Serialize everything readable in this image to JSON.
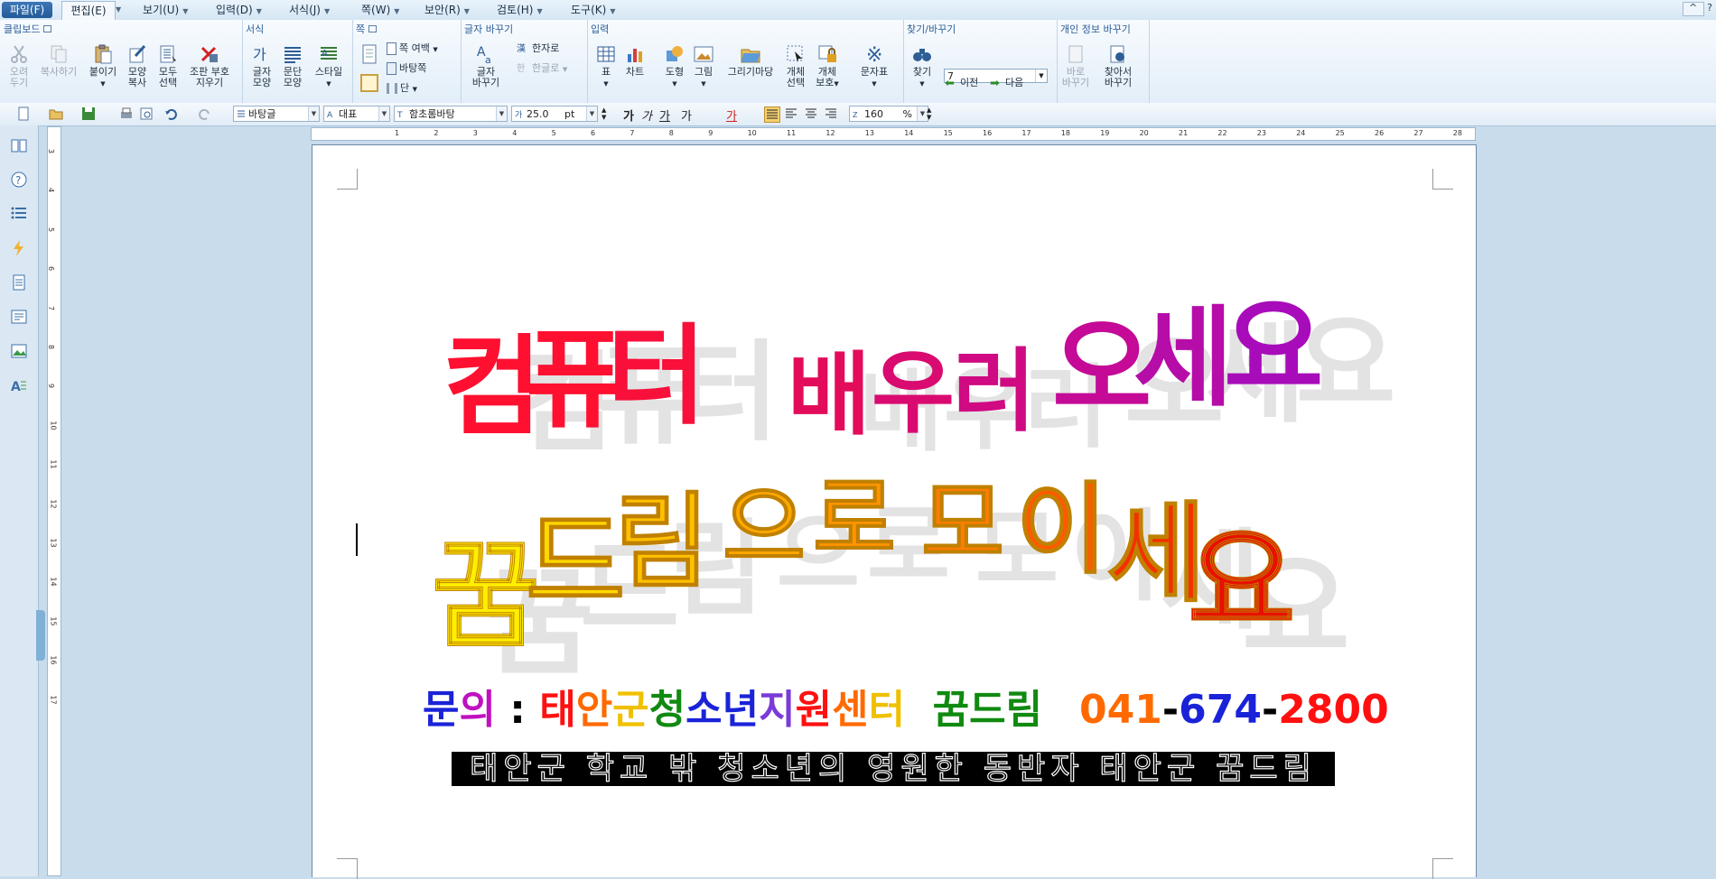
{
  "menu": {
    "items": [
      "파일(F)",
      "편집(E)",
      "보기(U)",
      "입력(D)",
      "서식(J)",
      "쪽(W)",
      "보안(R)",
      "검토(H)",
      "도구(K)"
    ],
    "help": [
      "^",
      "?"
    ]
  },
  "ribbon": {
    "clipboard": {
      "title": "클립보드",
      "cut": "오려\n두기",
      "copy": "복사하기",
      "paste": "붙이기",
      "format_copy": "모양\n복사",
      "select_all": "모두\n선택",
      "remove_marks": "조판 부호\n지우기"
    },
    "format": {
      "title": "서식",
      "char_shape": "글자\n모양",
      "para_shape": "문단\n모양",
      "style": "스타일"
    },
    "page": {
      "title": "쪽",
      "margin": "쪽 여백",
      "background": "바탕쪽",
      "columns": "단"
    },
    "convert": {
      "title": "글자 바꾸기",
      "change": "글자\n바꾸기",
      "hanja": "한자로",
      "hangul": "한글로"
    },
    "insert": {
      "title": "입력",
      "table": "표",
      "chart": "차트",
      "shape": "도형",
      "picture": "그림",
      "drawing": "그리기마당",
      "obj_select": "개체\n선택",
      "obj_protect": "개체\n보호",
      "charmap": "문자표"
    },
    "find": {
      "title": "찾기/바꾸기",
      "find": "찾기",
      "value": "7",
      "prev": "이전",
      "next": "다음"
    },
    "privacy": {
      "title": "개인 정보 바꾸기",
      "replace": "바로\n바꾸기",
      "find_replace": "찾아서\n바꾸기"
    }
  },
  "toolbar": {
    "style": "바탕글",
    "lang": "대표",
    "font": "함초롬바탕",
    "size": "25.0",
    "unit": "pt",
    "zoom": "160",
    "zoom_unit": "%",
    "bold": "가",
    "italic": "가",
    "underline": "가",
    "strike": "가",
    "color": "가"
  },
  "document": {
    "line1": {
      "text": [
        "컴",
        "퓨",
        "터",
        "배",
        "우",
        "러",
        "오",
        "세",
        "요"
      ],
      "colors": [
        "#ff1030",
        "#ff1030",
        "#f8103a",
        "#e30c5a",
        "#d90a70",
        "#cf0a82",
        "#c40a96",
        "#b60ca8",
        "#a80cba"
      ]
    },
    "line2": {
      "text": [
        "꿈",
        "드",
        "림",
        "으",
        "로",
        "모",
        "이",
        "세",
        "요"
      ],
      "colors": [
        "#ffee00",
        "#ffd800",
        "#ffc000",
        "#ffa800",
        "#ff9400",
        "#ff7c00",
        "#ff5a00",
        "#f53000",
        "#e81000"
      ]
    },
    "info": {
      "parts": [
        {
          "t": "문",
          "c": "#1a23d8"
        },
        {
          "t": "의",
          "c": "#c010c0"
        },
        {
          "t": " : ",
          "c": "#000000"
        },
        {
          "t": "태",
          "c": "#ff1010"
        },
        {
          "t": "안",
          "c": "#ff6a00"
        },
        {
          "t": "군",
          "c": "#f0c000"
        },
        {
          "t": "청",
          "c": "#108a10"
        },
        {
          "t": "소",
          "c": "#1a23d8"
        },
        {
          "t": "년",
          "c": "#1a23d8"
        },
        {
          "t": "지",
          "c": "#7a3bd8"
        },
        {
          "t": "원",
          "c": "#ff1010"
        },
        {
          "t": "센",
          "c": "#ff6a00"
        },
        {
          "t": "터",
          "c": "#f0c000"
        },
        {
          "t": "  꿈드림",
          "c": "#108a10"
        }
      ],
      "phone": [
        {
          "t": "041",
          "c": "#ff6a00"
        },
        {
          "t": "-",
          "c": "#000000"
        },
        {
          "t": "674",
          "c": "#1a23d8"
        },
        {
          "t": "-",
          "c": "#000000"
        },
        {
          "t": "2800",
          "c": "#ff1010"
        }
      ]
    },
    "slogan": "태안군 학교 밖 청소년의 영원한 동반자 태안군 꿈드림"
  },
  "ruler": {
    "h_numbers": [
      "1",
      "2",
      "3",
      "4",
      "5",
      "6",
      "7",
      "8",
      "9",
      "10",
      "11",
      "12",
      "13",
      "14",
      "15",
      "16",
      "17",
      "18",
      "19",
      "20",
      "21",
      "22",
      "23",
      "24",
      "25",
      "26",
      "27",
      "28"
    ],
    "v_numbers": [
      "3",
      "4",
      "5",
      "6",
      "7",
      "8",
      "9",
      "10",
      "11",
      "12",
      "13",
      "14",
      "15",
      "16",
      "17"
    ]
  }
}
